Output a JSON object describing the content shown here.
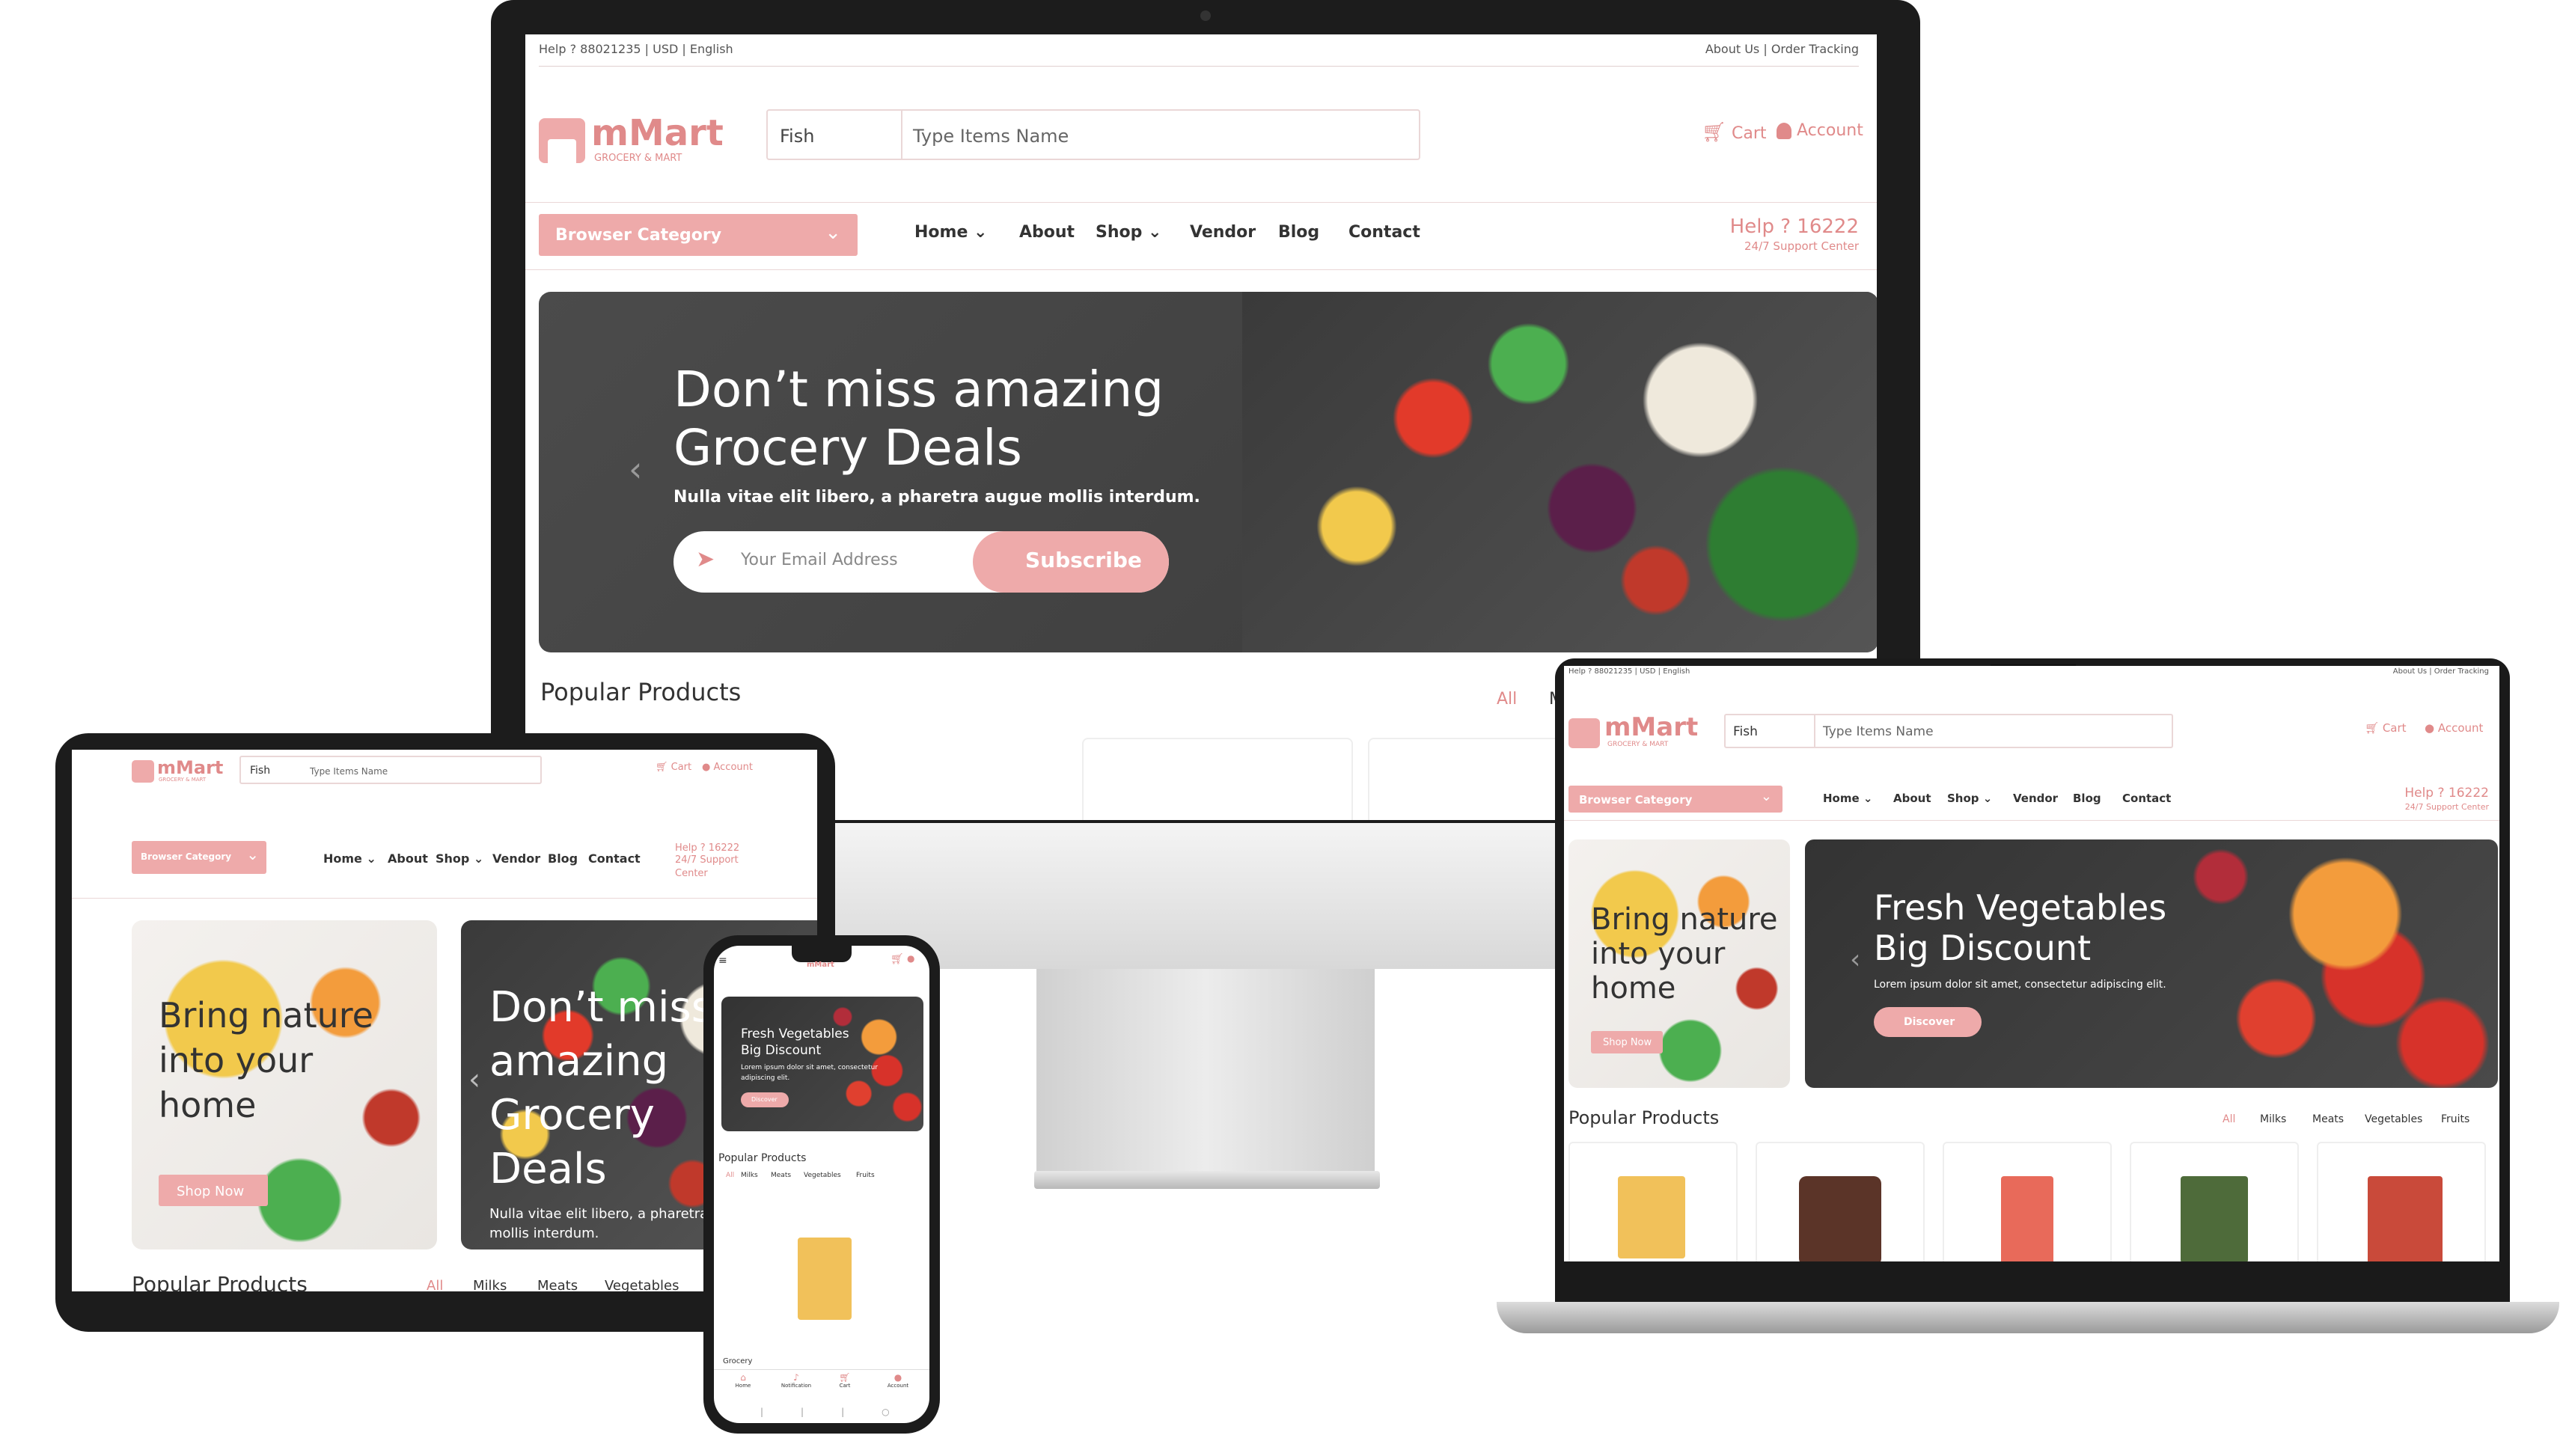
{
  "topbar": {
    "help": "Help ? 88021235",
    "currency": "USD",
    "language": "English",
    "about": "About Us",
    "tracking": "Order Tracking"
  },
  "brand": {
    "name": "mMart",
    "tagline": "GROCERY & MART"
  },
  "search": {
    "category": "Fish",
    "placeholder": "Type Items Name"
  },
  "actions": {
    "cart": "Cart",
    "account": "Account"
  },
  "nav": {
    "browse": "Browser Category",
    "home": "Home",
    "about": "About",
    "shop": "Shop",
    "vendor": "Vendor",
    "blog": "Blog",
    "contact": "Contact",
    "help": "Help ? 16222",
    "support": "24/7 Support Center",
    "support_line1": "24/7 Support",
    "support_line2": "Center"
  },
  "hero": {
    "line1": "Don’t miss amazing",
    "line2": "Grocery Deals",
    "sub": "Nulla vitae elit libero, a pharetra augue mollis interdum.",
    "email_placeholder": "Your Email Address",
    "subscribe": "Subscribe"
  },
  "tablet_hero": {
    "l1": "Don’t miss",
    "l2": "amazing",
    "l3": "Grocery",
    "l4": "Deals",
    "sub": "Nulla vitae elit libero, a pharetra",
    "sub2": "mollis interdum."
  },
  "promo1": {
    "l1": "Bring nature",
    "l2": "into your",
    "l3": "home",
    "cta": "Shop Now"
  },
  "promo2": {
    "l1": "Fresh Vegetables",
    "l2": "Big Discount",
    "sub": "Lorem ipsum dolor sit amet, consectetur adipiscing elit.",
    "sub_a": "Lorem ipsum dolor sit amet, consectetur",
    "sub_b": "adipiscing elit.",
    "cta": "Discover"
  },
  "products": {
    "title": "Popular Products",
    "tabs": [
      "All",
      "Milks",
      "Meats",
      "Vegetables",
      "Fruits"
    ],
    "tab_cut": "M"
  },
  "phone": {
    "category_label": "Grocery",
    "bottom_nav": [
      "Home",
      "Notification",
      "Cart",
      "Account"
    ]
  },
  "colors": {
    "accent": "#eeaaaa",
    "accent_text": "#e08a8a",
    "device": "#1c1c1c"
  }
}
